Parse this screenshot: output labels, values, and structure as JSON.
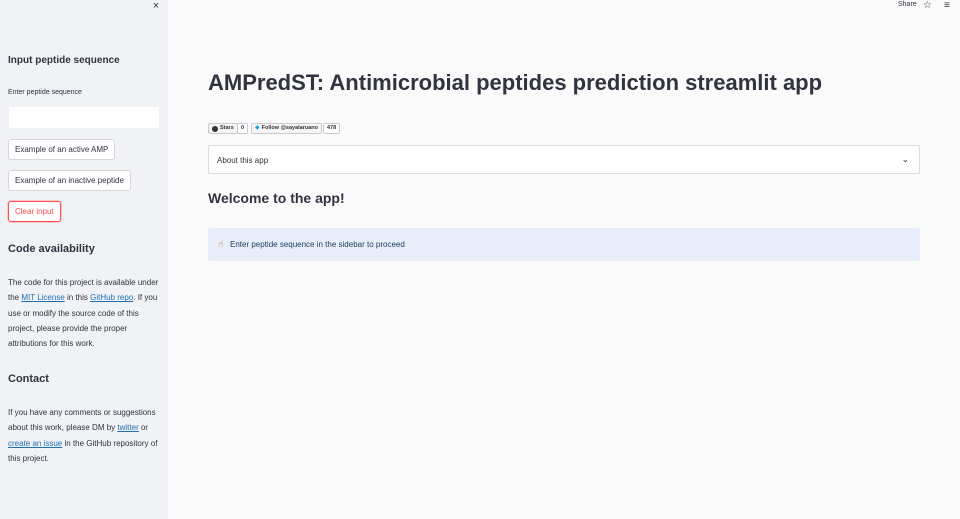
{
  "sidebar": {
    "close_icon": "×",
    "input_heading": "Input peptide sequence",
    "input_label": "Enter peptide sequence",
    "input_value": "",
    "input_placeholder": "",
    "btn_active": "Example of an active AMP",
    "btn_inactive": "Example of an inactive peptide",
    "btn_clear": "Clear input",
    "code_heading": "Code availability",
    "code_text_1": "The code for this project is available under the ",
    "code_link_license": "MIT License",
    "code_text_2": " in this ",
    "code_link_repo": "GitHub repo",
    "code_text_3": ". If you use or modify the source code of this project, please provide the proper attributions for this work.",
    "contact_heading": "Contact",
    "contact_text_1": "If you have any comments or suggestions about this work, please DM by ",
    "contact_link_twitter": "twitter",
    "contact_text_2": " or ",
    "contact_link_issue": "create an issue",
    "contact_text_3": " in the GitHub repository of this project."
  },
  "topbar": {
    "share_label": "Share",
    "star_icon": "☆",
    "menu_icon": "≡"
  },
  "main": {
    "title": "AMPredST: Antimicrobial peptides prediction streamlit app",
    "badge_stars_label": "Stars",
    "badge_stars_count": "0",
    "badge_twitter_label": "Follow @sayalaruano",
    "badge_twitter_count": "478",
    "expander_label": "About this app",
    "expander_icon": "⌄",
    "welcome": "Welcome to the app!",
    "info_icon": "☝",
    "info_text": "Enter peptide sequence in the sidebar to proceed"
  },
  "colors": {
    "sidebar_bg": "#f0f2f6",
    "accent_red": "#ff4b4b",
    "info_bg": "#e7eefa",
    "link": "#1f6fb5"
  }
}
